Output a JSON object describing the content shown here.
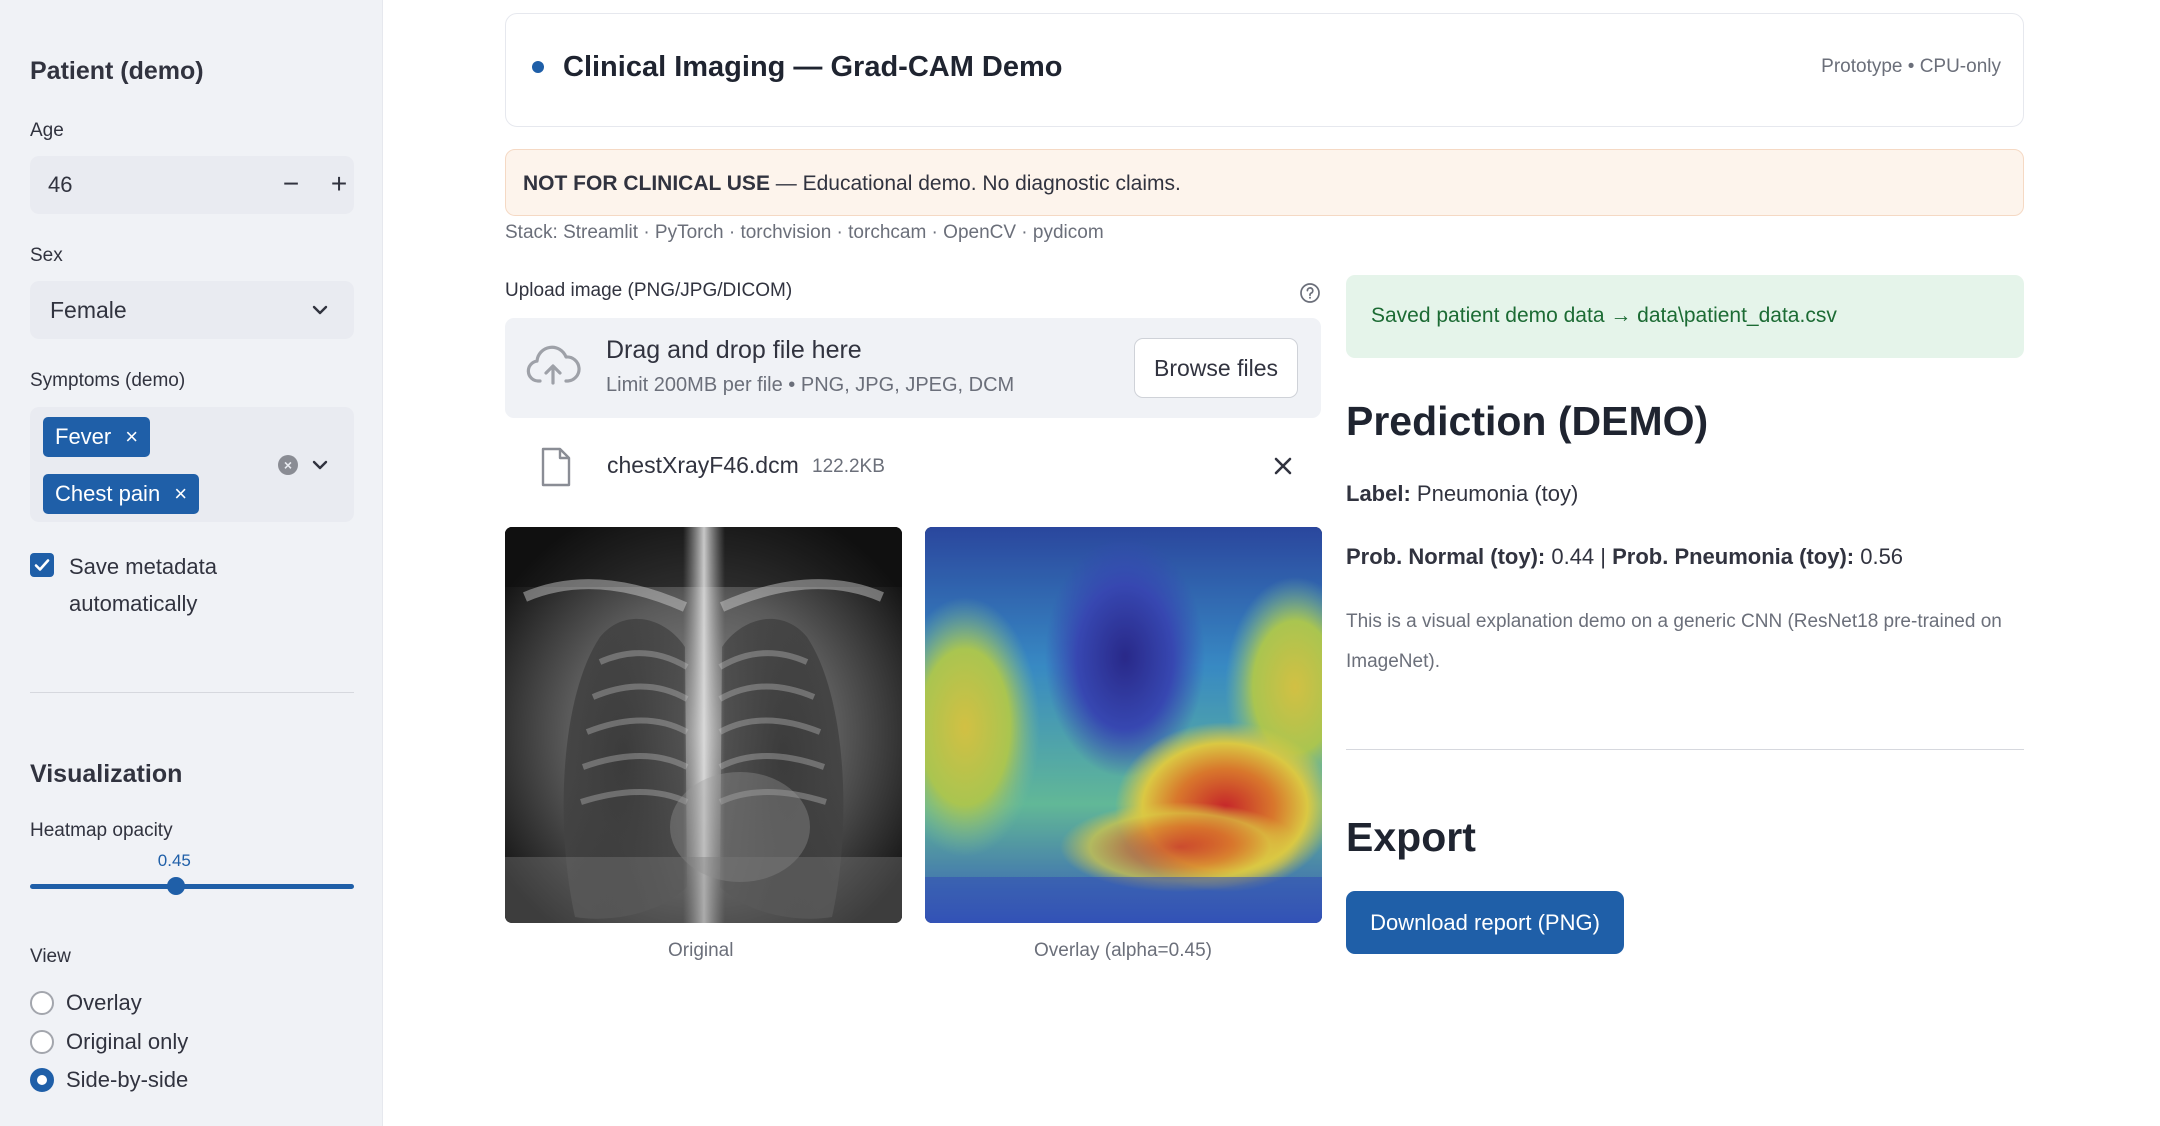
{
  "sidebar": {
    "patient_title": "Patient (demo)",
    "age_label": "Age",
    "age_value": "46",
    "age_minus": "−",
    "age_plus": "+",
    "sex_label": "Sex",
    "sex_value": "Female",
    "symptoms_label": "Symptoms (demo)",
    "symptoms": [
      {
        "label": "Fever"
      },
      {
        "label": "Chest pain"
      }
    ],
    "tag_remove": "×",
    "clear_all": "×",
    "save_metadata_line1": "Save metadata",
    "save_metadata_line2": "automatically",
    "save_metadata_checked": true,
    "visualization_title": "Visualization",
    "opacity_label": "Heatmap opacity",
    "opacity_value": "0.45",
    "opacity_fraction": 0.45,
    "view_label": "View",
    "view_options": [
      {
        "label": "Overlay",
        "selected": false
      },
      {
        "label": "Original only",
        "selected": false
      },
      {
        "label": "Side-by-side",
        "selected": true
      }
    ]
  },
  "header": {
    "title": "Clinical Imaging — Grad-CAM Demo",
    "meta": "Prototype • CPU-only"
  },
  "warning": {
    "bold": "NOT FOR CLINICAL USE",
    "text": " — Educational demo. No diagnostic claims."
  },
  "stack_text": "Stack: Streamlit · PyTorch · torchvision · torchcam · OpenCV · pydicom",
  "uploader": {
    "label": "Upload image (PNG/JPG/DICOM)",
    "drop_text": "Drag and drop file here",
    "limit_text": "Limit 200MB per file • PNG, JPG, JPEG, DCM",
    "browse_label": "Browse files",
    "file_name": "chestXrayF46.dcm",
    "file_size": "122.2KB"
  },
  "images": {
    "original_caption": "Original",
    "overlay_caption": "Overlay (alpha=0.45)"
  },
  "success_text": "Saved patient demo data → data\\patient_data.csv",
  "prediction": {
    "heading": "Prediction (DEMO)",
    "label_key": "Label:",
    "label_value": " Pneumonia (toy)",
    "prob_normal_key": "Prob. Normal (toy):",
    "prob_normal_value": " 0.44 | ",
    "prob_pneumonia_key": "Prob. Pneumonia (toy):",
    "prob_pneumonia_value": " 0.56",
    "note": "This is a visual explanation demo on a generic CNN (ResNet18 pre-trained on ImageNet)."
  },
  "export": {
    "heading": "Export",
    "button": "Download report (PNG)"
  },
  "colors": {
    "accent": "#1f5fa8",
    "sidebar_bg": "#f0f2f6",
    "warning_bg": "#fdf4ec",
    "success_bg": "#e5f4ea",
    "success_text": "#1c6b34"
  }
}
